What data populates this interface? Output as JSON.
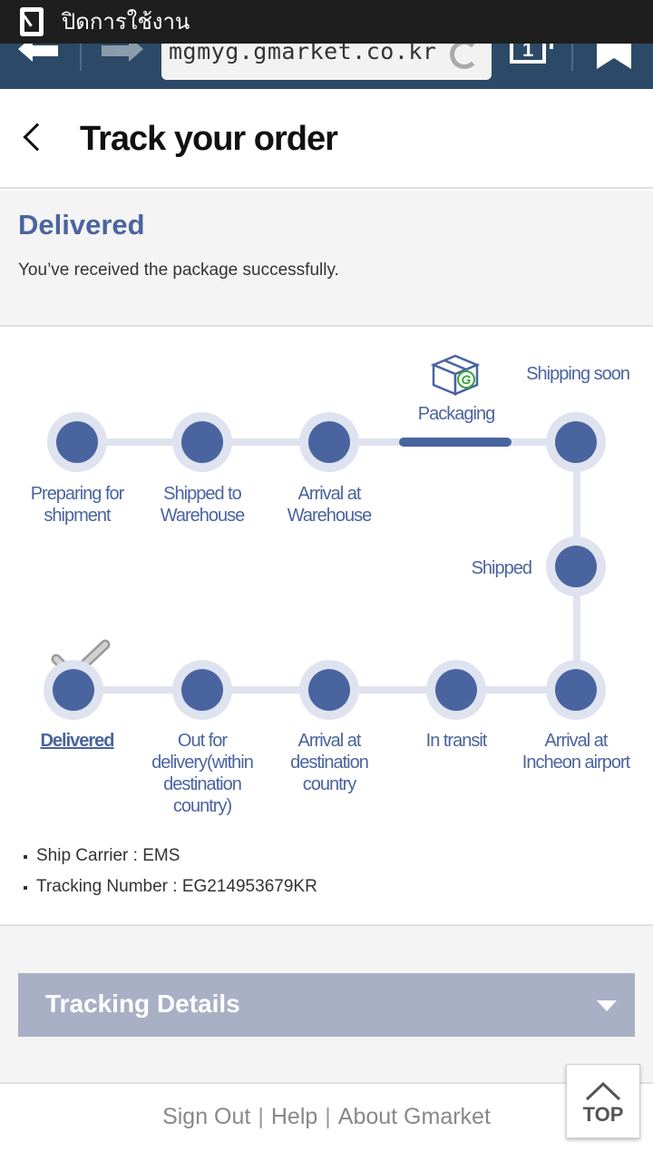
{
  "status_bar": {
    "text": "ปิดการใช้งาน"
  },
  "browser": {
    "url": "mgmyg.gmarket.co.kr",
    "tab_count": "1"
  },
  "header": {
    "title": "Track your order"
  },
  "status": {
    "title": "Delivered",
    "description": "You’ve received the package successfully."
  },
  "tracker": {
    "steps": [
      {
        "label_lines": [
          "Preparing for",
          "shipment"
        ]
      },
      {
        "label_lines": [
          "Shipped to",
          "Warehouse"
        ]
      },
      {
        "label_lines": [
          "Arrival at",
          "Warehouse"
        ]
      },
      {
        "label_lines": [
          "Packaging"
        ]
      },
      {
        "label_lines": [
          "Shipping soon"
        ]
      },
      {
        "label_lines": [
          "Shipped"
        ]
      },
      {
        "label_lines": [
          "Arrival at",
          "Incheon airport"
        ]
      },
      {
        "label_lines": [
          "In transit"
        ]
      },
      {
        "label_lines": [
          "Arrival at",
          "destination",
          "country"
        ]
      },
      {
        "label_lines": [
          "Out for",
          "delivery(within",
          "destination",
          "country)"
        ]
      },
      {
        "label_lines": [
          "Delivered"
        ]
      }
    ],
    "current_step": "Delivered",
    "package_icon_letter": "G"
  },
  "shipping_info": {
    "carrier": "Ship Carrier : EMS",
    "tracking_number": "Tracking Number : EG214953679KR"
  },
  "details": {
    "title": "Tracking Details"
  },
  "footer": {
    "links": [
      "Sign Out",
      "Help",
      "About Gmarket"
    ],
    "separator": "|",
    "top_label": "TOP"
  }
}
